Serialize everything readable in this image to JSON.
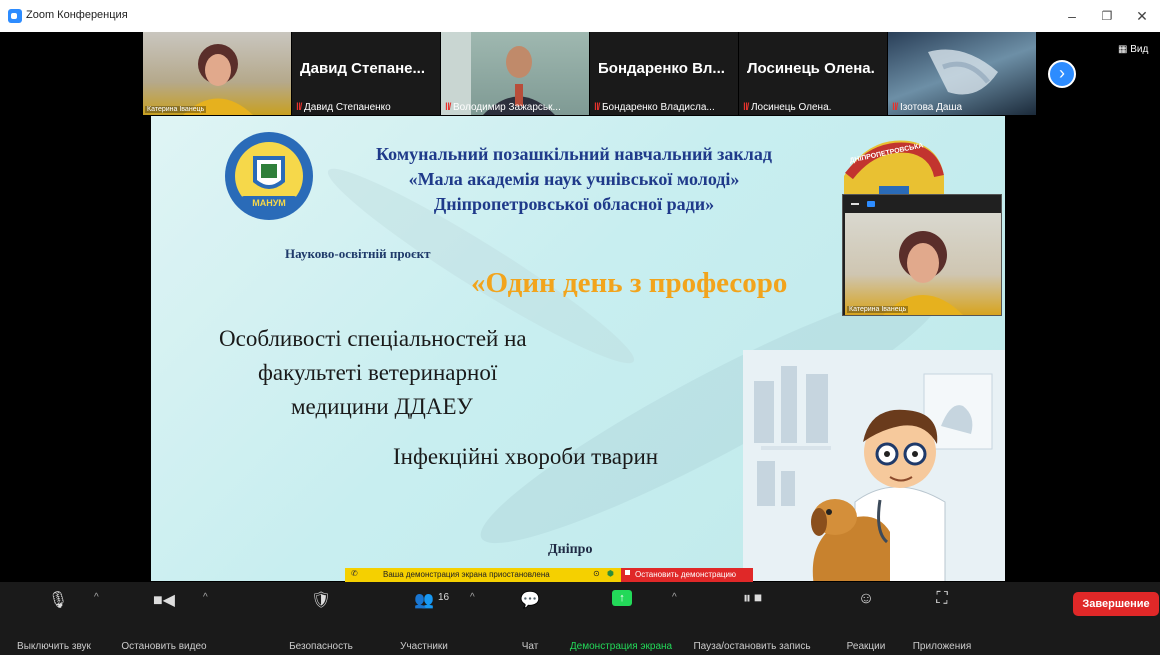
{
  "window": {
    "title": "Zoom Конференция",
    "minimize": "–",
    "restore": "❐",
    "close": "✕"
  },
  "gallery": {
    "tiles": [
      {
        "type": "video",
        "label": "Катерина Іванець"
      },
      {
        "type": "name",
        "big": "Давид  Степане...",
        "small": "Давид Степаненко"
      },
      {
        "type": "video",
        "label": "Володимир Зажарськ..."
      },
      {
        "type": "name",
        "big": "Бондаренко  Вл...",
        "small": "Бондаренко Владисла..."
      },
      {
        "type": "name",
        "big": "Лосинець Олена.",
        "small": "Лосинець Олена."
      },
      {
        "type": "video",
        "label": "Ізотова Даша"
      }
    ],
    "next_icon": "chevron-right-icon",
    "view_label": "Вид"
  },
  "slide": {
    "institution_line1": "Комунальний позашкільний навчальний заклад",
    "institution_line2": "«Мала академія наук учнівської молоді»",
    "institution_line3": "Дніпропетровської обласної ради»",
    "project_label": "Науково-освітній проєкт",
    "project_title": "«Один день з професоро",
    "topic_line1": "Особливості спеціальностей на",
    "topic_line2": "факультеті ветеринарної",
    "topic_line3": "медицини ДДАЕУ",
    "subtopic": "Інфекційні хвороби тварин",
    "city": "Дніпро",
    "logo_text": "МАНУМ",
    "region_badge": "ДНІПРОПЕТРОВСЬКА"
  },
  "self_view": {
    "label": "Катерина Іванець"
  },
  "share_bar": {
    "paused_text": "Ваша демонстрация экрана приостановлена",
    "stop_text": "Остановить демонстрацию"
  },
  "toolbar": {
    "mute": "Выключить звук",
    "video": "Остановить видео",
    "security": "Безопасность",
    "participants": "Участники",
    "participants_count": "16",
    "chat": "Чат",
    "share": "Демонстрация экрана",
    "record": "Пауза/остановить запись",
    "reactions": "Реакции",
    "apps": "Приложения",
    "end": "Завершение"
  },
  "colors": {
    "accent": "#2d8cff",
    "end": "#e02828",
    "share_green": "#23d959",
    "slide_title": "#1f3a8a",
    "project_orange": "#f2a41c"
  }
}
